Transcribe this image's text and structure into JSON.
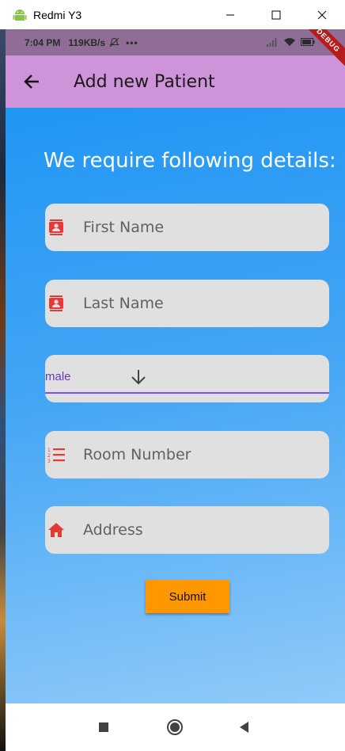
{
  "window": {
    "title": "Redmi Y3",
    "icons": {
      "app": "android-icon",
      "minimize": "minimize-icon",
      "maximize": "maximize-icon",
      "close": "close-icon"
    }
  },
  "status_bar": {
    "time": "7:04 PM",
    "speed": "119KB/s",
    "more": "•••",
    "badge": "DEBUG"
  },
  "appbar": {
    "title": "Add new Patient",
    "back_icon": "arrow-back-icon"
  },
  "form": {
    "heading": "We require following details:",
    "first_name": {
      "placeholder": "First Name",
      "icon": "contact-card-icon"
    },
    "last_name": {
      "placeholder": "Last Name",
      "icon": "contact-card-icon"
    },
    "gender": {
      "value": "male",
      "icon": "arrow-down-icon"
    },
    "room": {
      "placeholder": "Room Number",
      "icon": "numbered-list-icon"
    },
    "address": {
      "placeholder": "Address",
      "icon": "home-icon"
    },
    "submit_label": "Submit"
  },
  "colors": {
    "appbar": "#ce93d8",
    "icon_red": "#e53935",
    "accent": "#7c4dff",
    "button": "#ff9800",
    "background_top": "#2196f3",
    "background_bottom": "#90caf9"
  }
}
